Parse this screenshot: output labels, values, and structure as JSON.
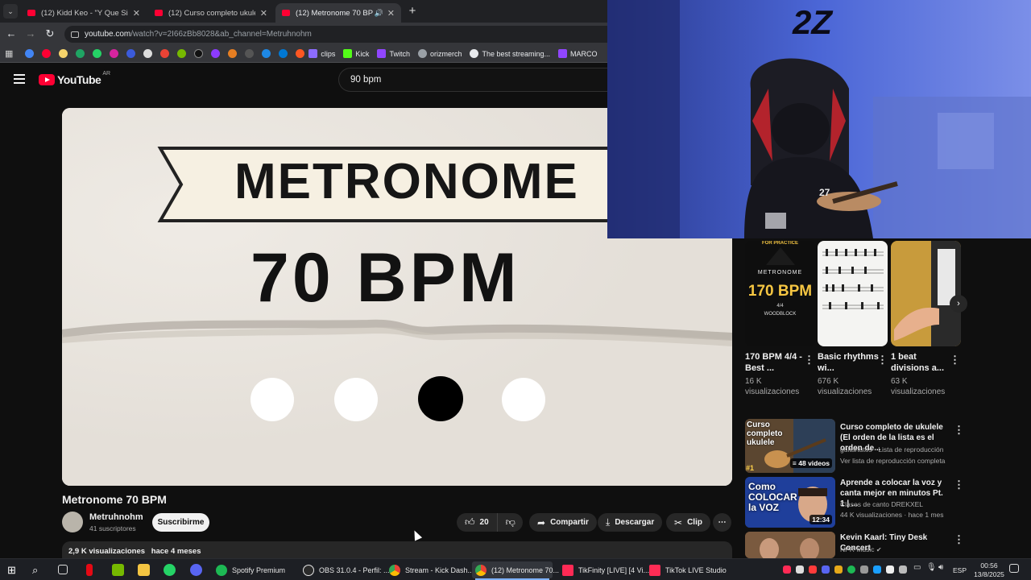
{
  "browser": {
    "tabs": [
      {
        "title": "(12) Kidd Keo - \"Y Que Si No Ha",
        "active": false
      },
      {
        "title": "(12) Curso completo ukulele: Tu",
        "active": false
      },
      {
        "title": "(12) Metronome 70 BPM - Y",
        "active": true
      }
    ],
    "url_domain": "youtube.com",
    "url_rest": "/watch?v=2I66zBb8028&ab_channel=Metruhnohm",
    "bookmarks": [
      {
        "label": "clips",
        "color": "#8c6cff"
      },
      {
        "label": "Kick",
        "color": "#53fc18"
      },
      {
        "label": "Twitch",
        "color": "#9146ff"
      },
      {
        "label": "orizmerch",
        "color": "#9aa0a6"
      },
      {
        "label": "The best streaming...",
        "color": "#e8eaed"
      },
      {
        "label": "MARCO",
        "color": "#9146ff"
      }
    ]
  },
  "youtube": {
    "logo_word": "YouTube",
    "country": "AR",
    "search_query": "90 bpm"
  },
  "player": {
    "banner_text": "METRONOME",
    "bpm_text": "70 BPM",
    "active_beat": 3,
    "beat_count": 4
  },
  "video": {
    "title": "Metronome 70 BPM",
    "channel": "Metruhnohm",
    "subscribers": "41 suscriptores",
    "subscribe_label": "Suscribirme",
    "likes": "20",
    "share_label": "Compartir",
    "download_label": "Descargar",
    "clip_label": "Clip",
    "views": "2,9 K visualizaciones",
    "age": "hace 4 meses"
  },
  "webcam": {
    "jersey_number": "27",
    "wall_logo": "2Z"
  },
  "shorts": [
    {
      "title": "170 BPM 4/4 - Best ...",
      "views": "16 K visualizaciones",
      "thumb_lines": [
        "FOR PRACTICE",
        "METRONOME",
        "170 BPM",
        "4/4",
        "WOODBLOCK"
      ]
    },
    {
      "title": "Basic rhythms wi...",
      "views": "676 K visualizaciones"
    },
    {
      "title": "1 beat divisions a...",
      "views": "63 K visualizaciones"
    }
  ],
  "recommendations": [
    {
      "title": "Curso completo de ukulele (El orden de la lista es el orden de...",
      "meta1": "guitartutos · Lista de reproducción",
      "meta2": "Ver lista de reproducción completa",
      "thumb_text": "Curso completo ukulele",
      "badge": "48 videos",
      "rank": "#1"
    },
    {
      "title": "Aprende a colocar la voz y canta mejor en minutos Pt. 1 | ...",
      "meta1": "Clases de canto DREKXEL",
      "meta2": "44 K visualizaciones · hace 1 mes",
      "thumb_text": "Como COLOCAR la VOZ",
      "duration": "12:34"
    },
    {
      "title": "Kevin Kaarl: Tiny Desk Concert",
      "meta1": "NPR Music",
      "meta2": ""
    }
  ],
  "taskbar": {
    "apps": [
      {
        "label": "Spotify Premium",
        "color": "#1db954"
      },
      {
        "label": "OBS 31.0.4 - Perfil: ...",
        "color": "#e6e6e6"
      },
      {
        "label": "Stream - Kick Dash...",
        "color": "#4285f4"
      },
      {
        "label": "(12) Metronome 70...",
        "color": "#4285f4"
      },
      {
        "label": "TikFinity [LIVE] [4 Vi...",
        "color": "#ff2a55"
      },
      {
        "label": "TikTok LIVE Studio",
        "color": "#fe2c55"
      }
    ],
    "language": "ESP",
    "time": "00:56",
    "date": "13/8/2025"
  }
}
